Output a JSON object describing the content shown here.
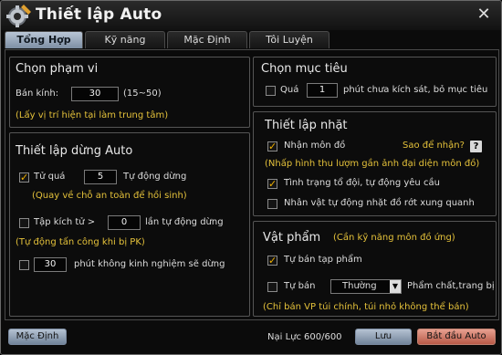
{
  "window": {
    "title": "Thiết lập Auto"
  },
  "tabs": [
    "Tổng Hợp",
    "Kỹ năng",
    "Mặc Định",
    "Tôi Luyện"
  ],
  "range": {
    "title": "Chọn phạm vi",
    "radius_label": "Bán kính:",
    "radius_value": "30",
    "radius_range": "(15~50)",
    "hint": "(Lấy vị trí hiện tại làm trung tâm)"
  },
  "stop": {
    "title": "Thiết lập dừng Auto",
    "over_label": "Tử quá",
    "over_value": "5",
    "over_suffix": "Tự động dừng",
    "over_hint": "(Quay về chỗ an toàn để hồi sinh)",
    "attack_label": "Tập kích tử >",
    "attack_value": "0",
    "attack_suffix": "lần tự động dừng",
    "attack_hint": "(Tự động tấn công khi bị PK)",
    "noexp_value": "30",
    "noexp_suffix": "phút không kinh nghiệm sẽ dừng"
  },
  "target": {
    "title": "Chọn mục tiêu",
    "over_label": "Quá",
    "over_value": "1",
    "over_suffix": "phút chưa kích sát, bỏ mục tiêu"
  },
  "pickup": {
    "title": "Thiết lập nhặt",
    "receive_label": "Nhận môn đồ",
    "how_label": "Sao để nhận?",
    "help_icon": "?",
    "receive_hint": "(Nhấp hình thu lượm gần ảnh đại diện môn đồ)",
    "team_label": "Tình trạng tổ đội, tự động yêu cầu",
    "auto_pick_label": "Nhân vật tự động nhặt đồ rớt xung quanh"
  },
  "items": {
    "title": "Vật phẩm",
    "title_hint": "(Cần kỹ năng môn đồ ứng)",
    "sell_junk_label": "Tự bán tạp phẩm",
    "sell_label": "Tự bán",
    "quality_value": "Thường",
    "quality_suffix": "Phẩm chất,trang bị",
    "sell_hint": "(Chỉ bán VP túi chính, túi nhỏ không thể bán)"
  },
  "footer": {
    "default_button": "Mặc Định",
    "durability_label": "Nại Lực",
    "durability_value": "600/600",
    "save_button": "Lưu",
    "start_button": "Bắt đầu Auto"
  },
  "checks": {
    "stop_over": true,
    "stop_attack": false,
    "stop_noexp": false,
    "target_over": false,
    "pickup_receive": true,
    "pickup_team": true,
    "pickup_auto": false,
    "sell_junk": true,
    "sell_quality": false
  }
}
